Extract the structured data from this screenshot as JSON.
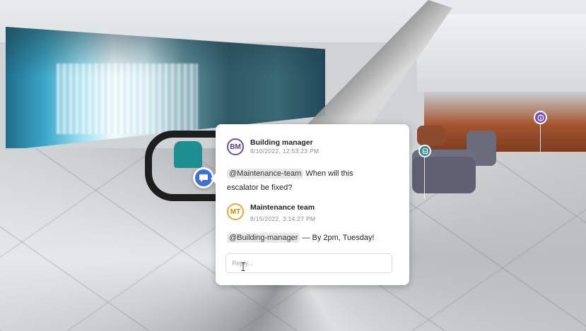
{
  "thread": {
    "comments": [
      {
        "initials": "BM",
        "author": "Building manager",
        "timestamp": "8/10/2022, 12:53:23 PM",
        "mention": "@Maintenance-team",
        "text_line1": " When will this",
        "text_line2": "escalator be fixed?"
      },
      {
        "initials": "MT",
        "author": "Maintenance team",
        "timestamp": "8/15/2022, 3:14:27 PM",
        "mention": "@Building-manager",
        "text_line1": " — By 2pm, Tuesday!"
      }
    ],
    "reply_placeholder": "Reply..."
  },
  "markers": {
    "main_icon": "comment-icon",
    "teal_icon": "bus-icon",
    "purple_icon": "info-icon"
  },
  "colors": {
    "marker_blue": "#3c6fd8",
    "marker_teal": "#2c8a9a",
    "marker_purple": "#7b4bb6",
    "avatar_bm": "#6a4ea1",
    "avatar_mt": "#e3a935"
  }
}
